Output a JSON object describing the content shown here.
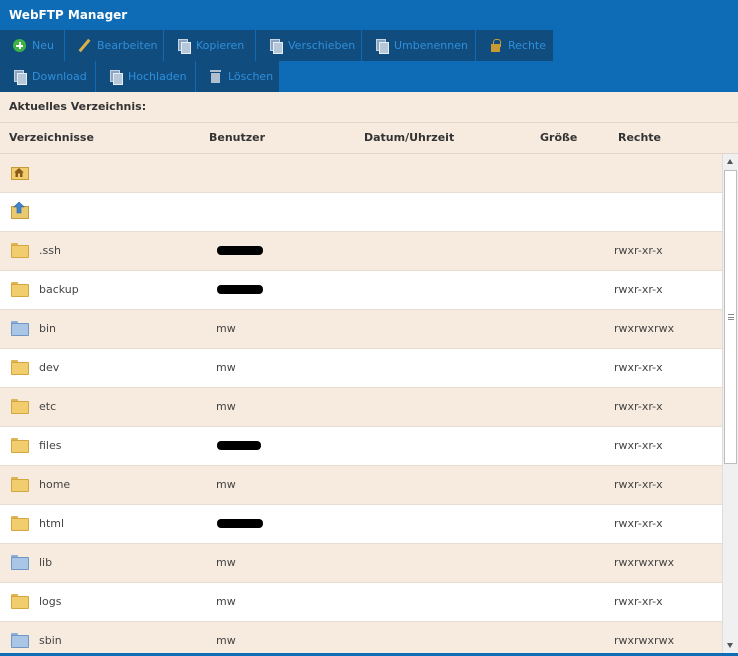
{
  "app": {
    "title": "WebFTP Manager"
  },
  "toolbar": {
    "row1": [
      {
        "label": "Neu",
        "icon": "plus-circle-icon"
      },
      {
        "label": "Bearbeiten",
        "icon": "pencil-icon"
      },
      {
        "label": "Kopieren",
        "icon": "copy-icon"
      },
      {
        "label": "Verschieben",
        "icon": "move-document-icon"
      },
      {
        "label": "Umbenennen",
        "icon": "rename-icon"
      },
      {
        "label": "Rechte",
        "icon": "lock-icon"
      }
    ],
    "row2": [
      {
        "label": "Download",
        "icon": "download-icon"
      },
      {
        "label": "Hochladen",
        "icon": "upload-icon"
      },
      {
        "label": "Löschen",
        "icon": "trash-icon"
      }
    ]
  },
  "current_dir": {
    "label": "Aktuelles Verzeichnis:"
  },
  "table": {
    "headers": {
      "name": "Verzeichnisse",
      "user": "Benutzer",
      "date": "Datum/Uhrzeit",
      "size": "Größe",
      "rights": "Rechte"
    },
    "rows": [
      {
        "type": "home",
        "name": "",
        "user": "",
        "user_redacted": false,
        "rights": ""
      },
      {
        "type": "up",
        "name": "",
        "user": "",
        "user_redacted": false,
        "rights": ""
      },
      {
        "type": "folder",
        "name": ".ssh",
        "user": "",
        "user_redacted": true,
        "rights": "rwxr-xr-x"
      },
      {
        "type": "folder",
        "name": "backup",
        "user": "",
        "user_redacted": true,
        "rights": "rwxr-xr-x"
      },
      {
        "type": "link",
        "name": "bin",
        "user": "mw",
        "user_redacted": false,
        "rights": "rwxrwxrwx"
      },
      {
        "type": "folder",
        "name": "dev",
        "user": "mw",
        "user_redacted": false,
        "rights": "rwxr-xr-x"
      },
      {
        "type": "folder",
        "name": "etc",
        "user": "mw",
        "user_redacted": false,
        "rights": "rwxr-xr-x"
      },
      {
        "type": "folder",
        "name": "files",
        "user": "",
        "user_redacted": true,
        "rights": "rwxr-xr-x"
      },
      {
        "type": "folder",
        "name": "home",
        "user": "mw",
        "user_redacted": false,
        "rights": "rwxr-xr-x"
      },
      {
        "type": "folder",
        "name": "html",
        "user": "",
        "user_redacted": true,
        "rights": "rwxr-xr-x"
      },
      {
        "type": "link",
        "name": "lib",
        "user": "mw",
        "user_redacted": false,
        "rights": "rwxrwxrwx"
      },
      {
        "type": "folder",
        "name": "logs",
        "user": "mw",
        "user_redacted": false,
        "rights": "rwxr-xr-x"
      },
      {
        "type": "link",
        "name": "sbin",
        "user": "mw",
        "user_redacted": false,
        "rights": "rwxrwxrwx"
      }
    ]
  },
  "colors": {
    "header_blue": "#0e6cb6",
    "button_dark": "#104c7e",
    "button_text": "#2f8fdc",
    "row_beige": "#f7ebdf"
  }
}
